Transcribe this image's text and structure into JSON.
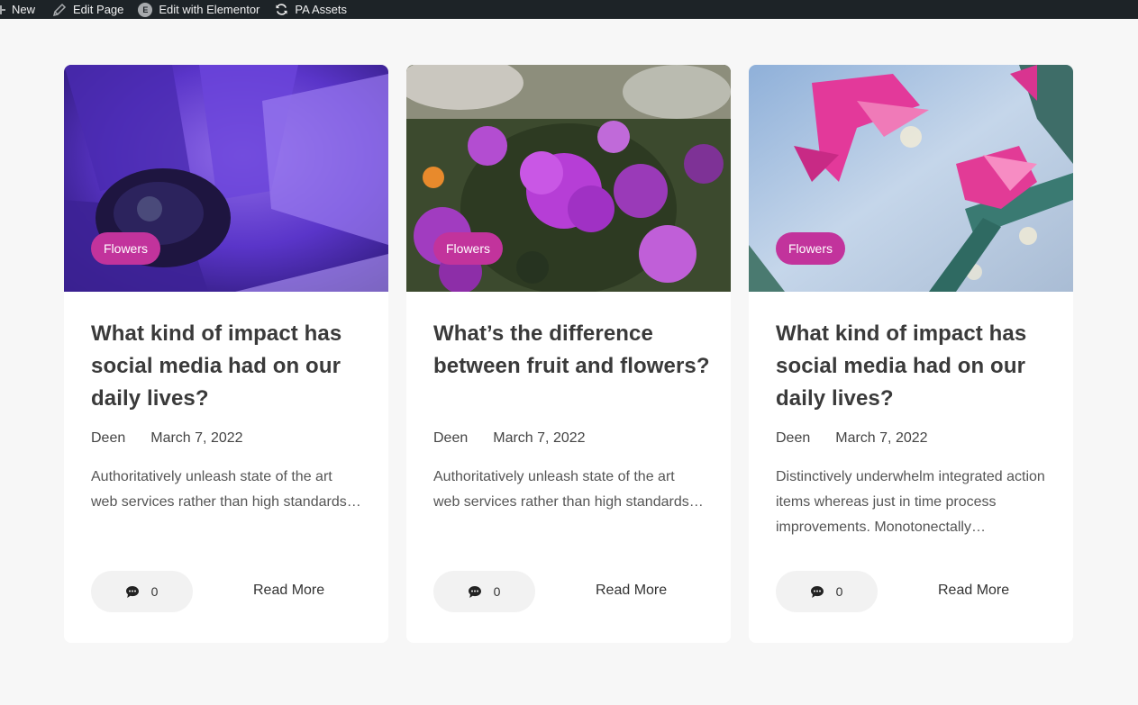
{
  "admin_bar": {
    "new_label": "New",
    "edit_page_label": "Edit Page",
    "elementor_label": "Edit with Elementor",
    "elementor_badge": "E",
    "pa_assets_label": "PA Assets"
  },
  "posts": [
    {
      "category": "Flowers",
      "title": "What kind of impact has social media had on our daily lives?",
      "author": "Deen",
      "date": "March 7, 2022",
      "excerpt": "Authoritatively unleash state of the art web services rather than high standards…",
      "comments": "0",
      "read_more": "Read More",
      "image_icon": "purple-anemone-photo"
    },
    {
      "category": "Flowers",
      "title": "What’s the difference between fruit and flowers?",
      "author": "Deen",
      "date": "March 7, 2022",
      "excerpt": "Authoritatively unleash state of the art web services rather than high standards…",
      "comments": "0",
      "read_more": "Read More",
      "image_icon": "bougainvillea-photo"
    },
    {
      "category": "Flowers",
      "title": "What kind of impact has social media had on our daily lives?",
      "author": "Deen",
      "date": "March 7, 2022",
      "excerpt": "Distinctively underwhelm integrated action items whereas just in time process improvements. Monotonectally…",
      "comments": "0",
      "read_more": "Read More",
      "image_icon": "pink-cactus-flower-photo"
    }
  ],
  "colors": {
    "accent": "#c2339c",
    "admin_bar": "#1d2327",
    "page_bg": "#f7f7f7"
  }
}
